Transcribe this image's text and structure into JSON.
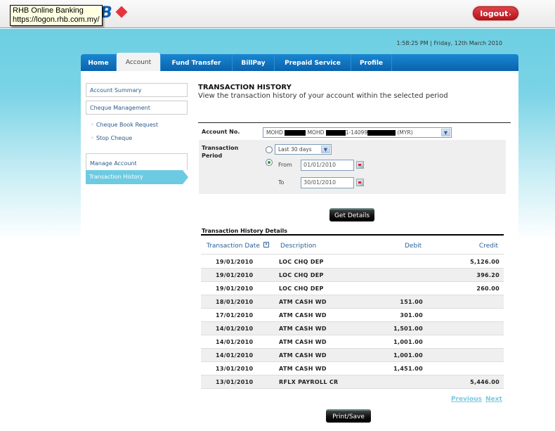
{
  "tooltip": {
    "line1": "RHB Online Banking",
    "line2": "https://logon.rhb.com.my/"
  },
  "header": {
    "logo_text": "B",
    "logout_label": "logout",
    "logout_arrow": "›",
    "datetime": "1:58:25 PM | Friday, 12th March 2010"
  },
  "nav": {
    "tabs": [
      {
        "label": "Home",
        "active": false
      },
      {
        "label": "Account",
        "active": true
      },
      {
        "label": "Fund Transfer",
        "active": false
      },
      {
        "label": "BillPay",
        "active": false
      },
      {
        "label": "Prepaid Service",
        "active": false
      },
      {
        "label": "Profile",
        "active": false
      }
    ]
  },
  "sidebar": {
    "account_summary": "Account Summary",
    "cheque_management": "Cheque Management",
    "cheque_book_request": "Cheque Book Request",
    "stop_cheque": "Stop Cheque",
    "manage_account": "Manage Account",
    "transaction_history": "Transaction History"
  },
  "page": {
    "title": "TRANSACTION HISTORY",
    "description": "View the transaction history of your account within the selected period"
  },
  "form": {
    "account_label": "Account No.",
    "account_value_parts": [
      "MOHD",
      "MOHD",
      "1-14099",
      "(MYR)"
    ],
    "period_label_1": "Transaction",
    "period_label_2": "Period",
    "period_option": "Last 30 days",
    "period_mode": "custom",
    "from_label": "From",
    "from_value": "01/01/2010",
    "to_label": "To",
    "to_value": "30/01/2010",
    "get_details_label": "Get Details"
  },
  "history": {
    "section_title": "Transaction History Details",
    "columns": {
      "date": "Transaction Date",
      "description": "Description",
      "debit": "Debit",
      "credit": "Credit"
    },
    "rows": [
      {
        "date": "19/01/2010",
        "description": "LOC CHQ DEP",
        "debit": "",
        "credit": "5,126.00"
      },
      {
        "date": "19/01/2010",
        "description": "LOC CHQ DEP",
        "debit": "",
        "credit": "396.20"
      },
      {
        "date": "19/01/2010",
        "description": "LOC CHQ DEP",
        "debit": "",
        "credit": "260.00"
      },
      {
        "date": "18/01/2010",
        "description": "ATM CASH WD",
        "debit": "151.00",
        "credit": ""
      },
      {
        "date": "17/01/2010",
        "description": "ATM CASH WD",
        "debit": "301.00",
        "credit": ""
      },
      {
        "date": "14/01/2010",
        "description": "ATM CASH WD",
        "debit": "1,501.00",
        "credit": ""
      },
      {
        "date": "14/01/2010",
        "description": "ATM CASH WD",
        "debit": "1,001.00",
        "credit": ""
      },
      {
        "date": "14/01/2010",
        "description": "ATM CASH WD",
        "debit": "1,001.00",
        "credit": ""
      },
      {
        "date": "13/01/2010",
        "description": "ATM CASH WD",
        "debit": "1,451.00",
        "credit": ""
      },
      {
        "date": "13/01/2010",
        "description": "RFLX PAYROLL CR",
        "debit": "",
        "credit": "5,446.00"
      }
    ],
    "previous_label": "Previous",
    "next_label": "Next",
    "print_save_label": "Print/Save"
  },
  "colors": {
    "brand_blue": "#0a63ad",
    "sky": "#6dcfe2",
    "logout_red": "#c41e26",
    "link": "#2a5f98",
    "pager_link": "#7cc7df"
  }
}
